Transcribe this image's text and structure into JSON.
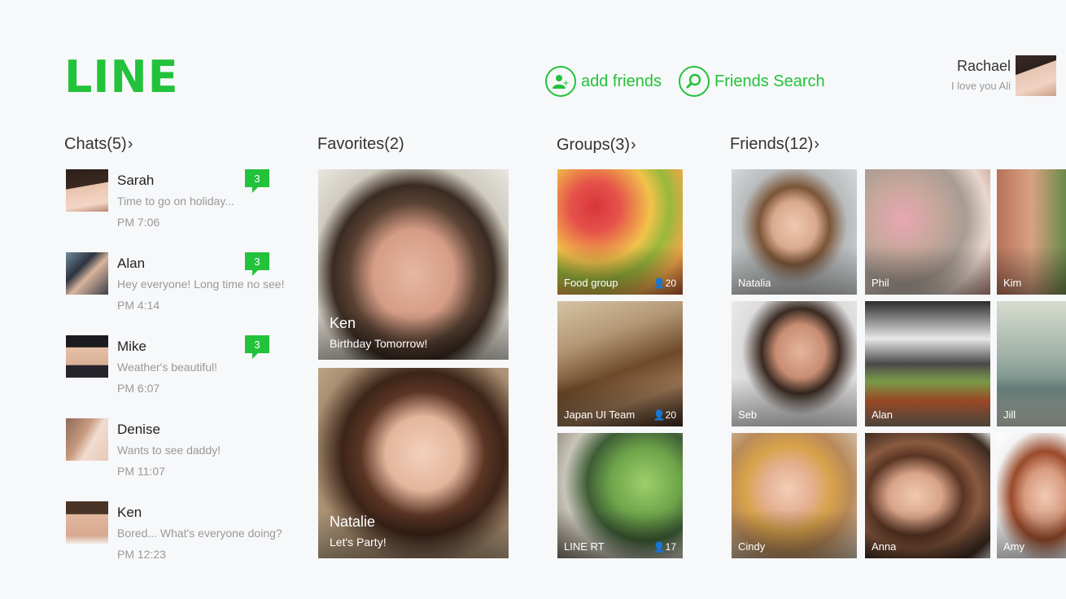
{
  "app": {
    "logo": "LINE"
  },
  "header": {
    "add_friends": "add friends",
    "friends_search": "Friends Search",
    "user_name": "Rachael",
    "user_status": "I love you Ali"
  },
  "sections": {
    "chats": "Chats(5)",
    "favorites": "Favorites(2)",
    "groups": "Groups(3)",
    "friends": "Friends(12)"
  },
  "chats": [
    {
      "name": "Sarah",
      "message": "Time to go on holiday...",
      "time": "PM 7:06",
      "unread": "3"
    },
    {
      "name": "Alan",
      "message": "Hey everyone! Long time no see!",
      "time": "PM 4:14",
      "unread": "3"
    },
    {
      "name": "Mike",
      "message": "Weather's beautiful!",
      "time": "PM 6:07",
      "unread": "3"
    },
    {
      "name": "Denise",
      "message": "Wants to see daddy!",
      "time": "PM 11:07"
    },
    {
      "name": "Ken",
      "message": "Bored... What's everyone doing?",
      "time": "PM 12:23"
    }
  ],
  "favorites": [
    {
      "name": "Ken",
      "status": "Birthday Tomorrow!"
    },
    {
      "name": "Natalie",
      "status": "Let's Party!"
    }
  ],
  "groups": [
    {
      "name": "Food group",
      "members": "20"
    },
    {
      "name": "Japan UI Team",
      "members": "20"
    },
    {
      "name": "LINE RT",
      "members": "17"
    }
  ],
  "friends": [
    {
      "name": "Natalia"
    },
    {
      "name": "Phil"
    },
    {
      "name": "Kim"
    },
    {
      "name": "Seb"
    },
    {
      "name": "Alan"
    },
    {
      "name": "Jill"
    },
    {
      "name": "Cindy"
    },
    {
      "name": "Anna"
    },
    {
      "name": "Amy"
    }
  ],
  "colors": {
    "accent": "#22c23a",
    "background": "#f7f8fa"
  }
}
